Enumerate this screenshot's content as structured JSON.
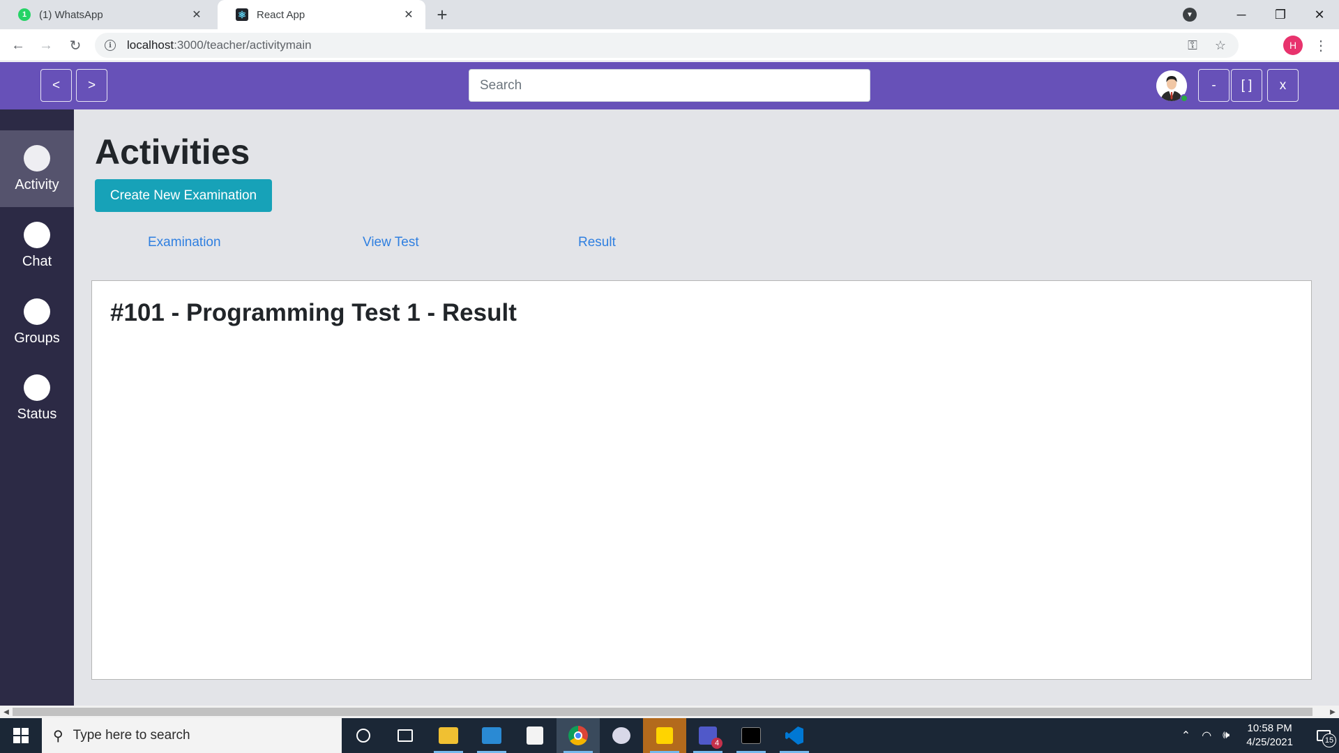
{
  "browser": {
    "tabs": [
      {
        "title": "(1) WhatsApp",
        "badge": "1",
        "active": false
      },
      {
        "title": "React App",
        "active": true
      }
    ],
    "url_host": "localhost",
    "url_rest": ":3000/teacher/activitymain",
    "profile_initial": "H"
  },
  "header": {
    "back_label": "<",
    "forward_label": ">",
    "search_placeholder": "Search",
    "minimize_label": "-",
    "maximize_label": "[ ]",
    "close_label": "x"
  },
  "sidebar": {
    "items": [
      {
        "label": "Activity",
        "active": true
      },
      {
        "label": "Chat",
        "active": false
      },
      {
        "label": "Groups",
        "active": false
      },
      {
        "label": "Status",
        "active": false
      }
    ]
  },
  "main": {
    "title": "Activities",
    "create_button": "Create New Examination",
    "subnav": [
      "Examination",
      "View Test",
      "Result"
    ],
    "result_title": "#101 - Programming Test 1 - Result"
  },
  "taskbar": {
    "search_placeholder": "Type here to search",
    "time": "10:58 PM",
    "date": "4/25/2021",
    "teams_badge": "4",
    "notification_count": "15"
  },
  "colors": {
    "header_bg": "#6751b8",
    "sidebar_bg": "#2c2a45",
    "sidebar_active": "#55536d",
    "primary_button": "#17a2b8",
    "link": "#2f7fe0",
    "online_status": "#28a745"
  }
}
